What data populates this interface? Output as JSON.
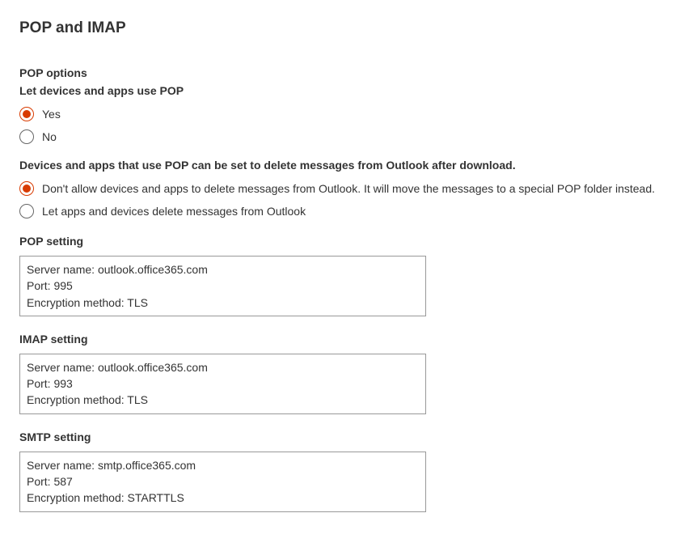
{
  "title": "POP and IMAP",
  "pop_options": {
    "heading": "POP options",
    "use_pop_label": "Let devices and apps use POP",
    "yes": "Yes",
    "no": "No",
    "use_pop_selected": "yes",
    "delete_label": "Devices and apps that use POP can be set to delete messages from Outlook after download.",
    "delete_option_dont": "Don't allow devices and apps to delete messages from Outlook. It will move the messages to a special POP folder instead.",
    "delete_option_allow": "Let apps and devices delete messages from Outlook",
    "delete_selected": "dont"
  },
  "labels": {
    "server_name_label": "Server name:",
    "port_label": "Port:",
    "encryption_label": "Encryption method:"
  },
  "pop_setting": {
    "heading": "POP setting",
    "server": "outlook.office365.com",
    "port": "995",
    "encryption": "TLS"
  },
  "imap_setting": {
    "heading": "IMAP setting",
    "server": "outlook.office365.com",
    "port": "993",
    "encryption": "TLS"
  },
  "smtp_setting": {
    "heading": "SMTP setting",
    "server": "smtp.office365.com",
    "port": "587",
    "encryption": "STARTTLS"
  }
}
